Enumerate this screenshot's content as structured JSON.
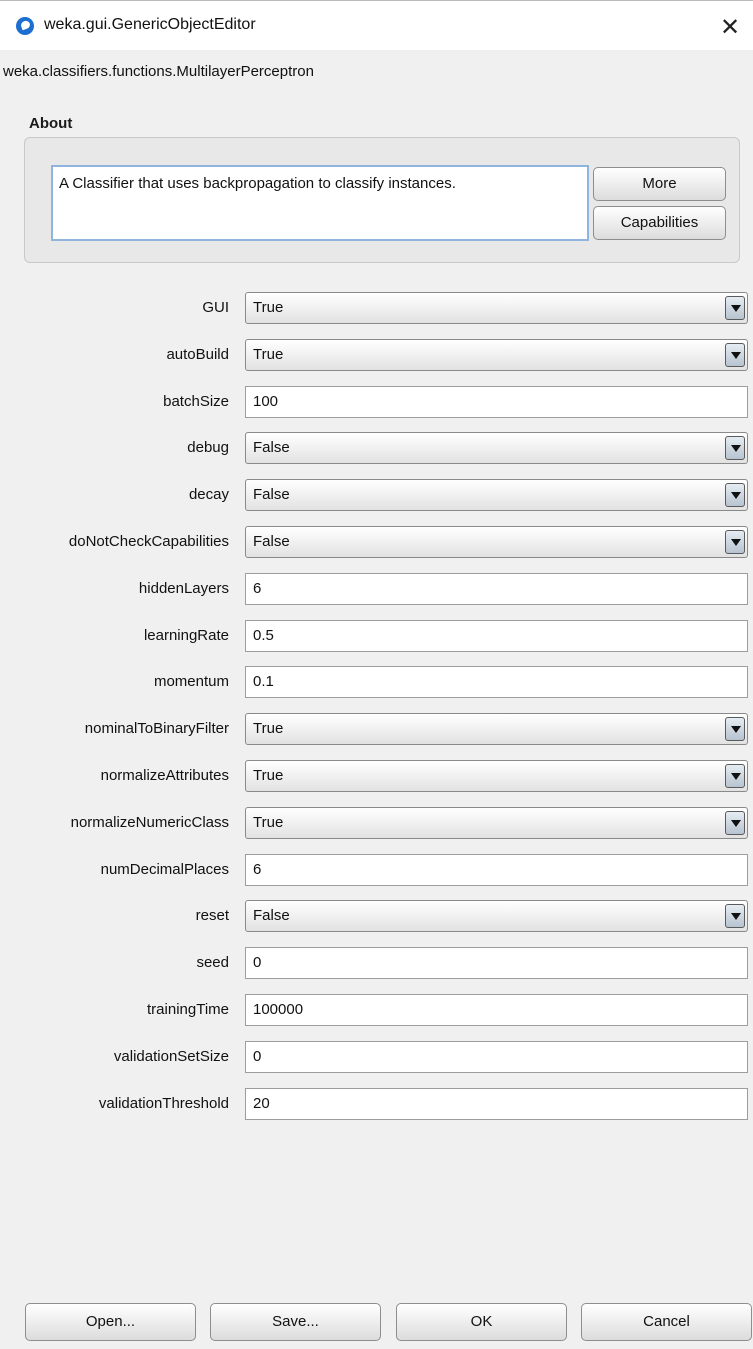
{
  "window": {
    "title": "weka.gui.GenericObjectEditor",
    "icon": "weka-bird-icon",
    "close_glyph": "✕"
  },
  "class_name": "weka.classifiers.functions.MultilayerPerceptron",
  "about": {
    "label": "About",
    "text": "A Classifier that uses backpropagation to classify instances.",
    "more_label": "More",
    "capabilities_label": "Capabilities"
  },
  "properties": [
    {
      "label": "GUI",
      "type": "combo",
      "value": "True"
    },
    {
      "label": "autoBuild",
      "type": "combo",
      "value": "True"
    },
    {
      "label": "batchSize",
      "type": "text",
      "value": "100"
    },
    {
      "label": "debug",
      "type": "combo",
      "value": "False"
    },
    {
      "label": "decay",
      "type": "combo",
      "value": "False"
    },
    {
      "label": "doNotCheckCapabilities",
      "type": "combo",
      "value": "False"
    },
    {
      "label": "hiddenLayers",
      "type": "text",
      "value": "6"
    },
    {
      "label": "learningRate",
      "type": "text",
      "value": "0.5"
    },
    {
      "label": "momentum",
      "type": "text",
      "value": "0.1"
    },
    {
      "label": "nominalToBinaryFilter",
      "type": "combo",
      "value": "True"
    },
    {
      "label": "normalizeAttributes",
      "type": "combo",
      "value": "True"
    },
    {
      "label": "normalizeNumericClass",
      "type": "combo",
      "value": "True"
    },
    {
      "label": "numDecimalPlaces",
      "type": "text",
      "value": "6"
    },
    {
      "label": "reset",
      "type": "combo",
      "value": "False"
    },
    {
      "label": "seed",
      "type": "text",
      "value": "0"
    },
    {
      "label": "trainingTime",
      "type": "text",
      "value": "100000"
    },
    {
      "label": "validationSetSize",
      "type": "text",
      "value": "0"
    },
    {
      "label": "validationThreshold",
      "type": "text",
      "value": "20"
    }
  ],
  "buttons": {
    "open": "Open...",
    "save": "Save...",
    "ok": "OK",
    "cancel": "Cancel"
  }
}
